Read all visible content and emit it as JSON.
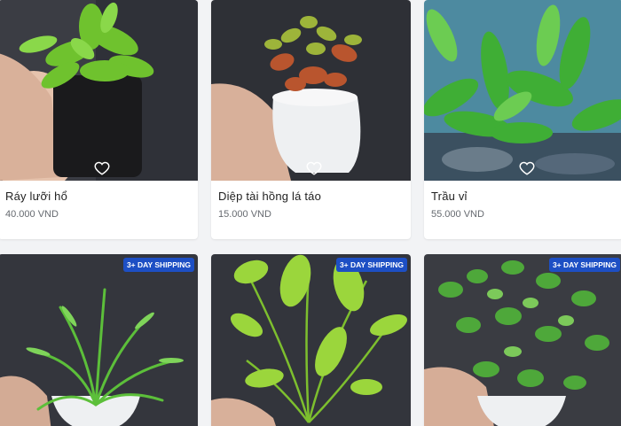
{
  "products": [
    {
      "title": "Ráy lưỡi hổ",
      "price": "40.000 VND",
      "favorite_icon": "heart-outline-icon"
    },
    {
      "title": "Diệp tài hồng lá táo",
      "price": "15.000 VND",
      "favorite_icon": "heart-outline-icon"
    },
    {
      "title": "Trầu vỉ",
      "price": "55.000 VND",
      "favorite_icon": "heart-outline-icon"
    },
    {
      "badge": "3+ DAY SHIPPING"
    },
    {
      "badge": "3+ DAY SHIPPING"
    },
    {
      "badge": "3+ DAY SHIPPING"
    }
  ],
  "colors": {
    "badge_bg": "#1d4fc4",
    "page_bg": "#f2f3f5",
    "card_bg": "#ffffff"
  }
}
